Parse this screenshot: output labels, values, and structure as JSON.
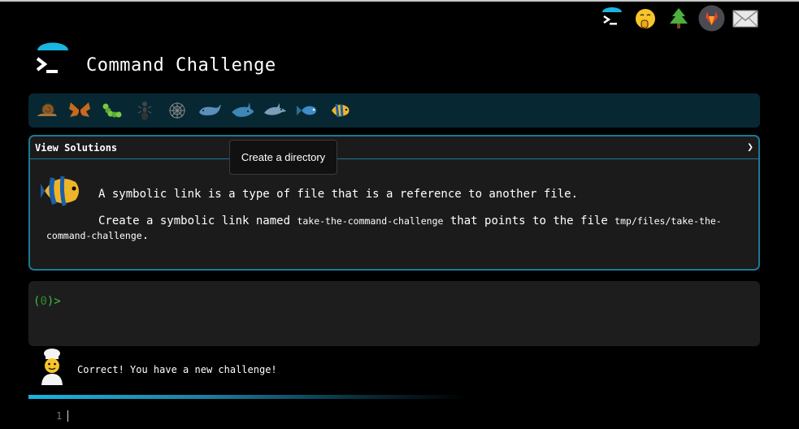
{
  "header": {
    "title": "Command Challenge",
    "top_icons": [
      "terminal-logo-icon",
      "face-with-hand-over-mouth-icon",
      "tree-icon",
      "gitlab-icon",
      "mail-icon"
    ]
  },
  "badges": {
    "icons": [
      "snail-icon",
      "butterfly-icon",
      "caterpillar-icon",
      "ant-icon",
      "spider-web-icon",
      "whale-icon",
      "shark-icon",
      "dolphin-icon",
      "fish-icon",
      "tropical-fish-icon"
    ]
  },
  "card": {
    "header_label": "View Solutions",
    "chevron": "❯",
    "line1": "A symbolic link is a type of file that is a reference to another file.",
    "line2_prefix": "Create a symbolic link named ",
    "line2_code1": "take-the-command-challenge",
    "line2_mid": " that points to the file ",
    "line2_code2": "tmp/files/take-the-command-challenge",
    "line2_suffix": "."
  },
  "tooltip": {
    "text": "Create a directory"
  },
  "terminal": {
    "prompt_open": "(",
    "prompt_num": "0",
    "prompt_close": ")>"
  },
  "status": {
    "message": "Correct! You have a new challenge!"
  },
  "editor": {
    "line_number": "1"
  },
  "colors": {
    "accent": "#1a7a96",
    "badge_bar": "#072833",
    "prompt": "#3fbf3f",
    "logo_blue": "#19b5e0"
  }
}
